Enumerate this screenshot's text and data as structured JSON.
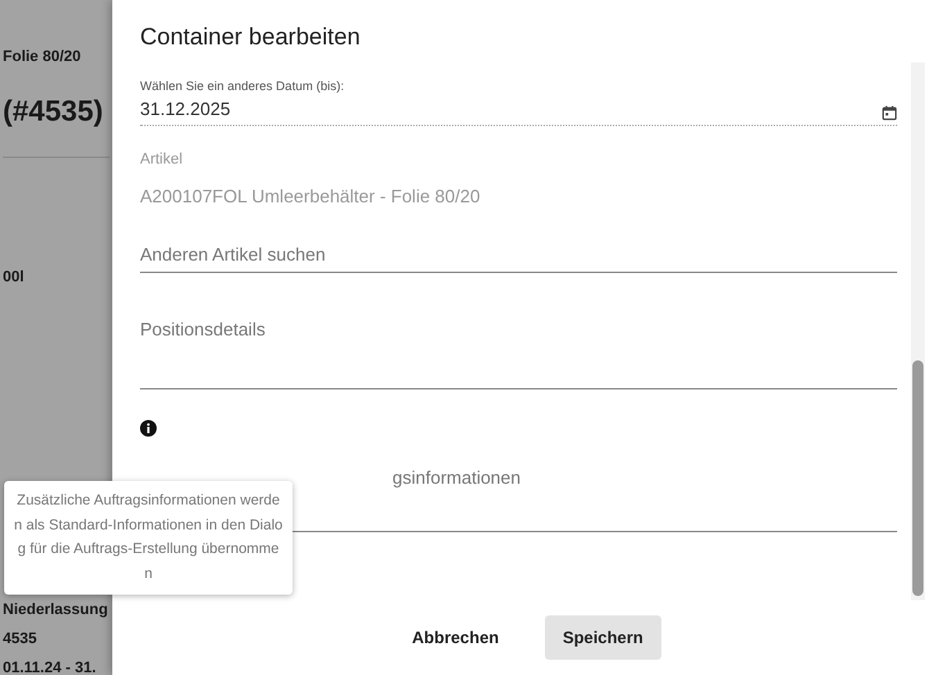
{
  "background": {
    "items": [
      {
        "kind": "subtitle",
        "text": "Folie 80/20"
      },
      {
        "kind": "heading",
        "text": "(#4535)"
      },
      {
        "kind": "value",
        "text": "00l"
      },
      {
        "kind": "label",
        "text": "Niederlassung"
      },
      {
        "kind": "value",
        "text": "4535"
      },
      {
        "kind": "value",
        "text": "01.11.24 - 31."
      }
    ]
  },
  "dialog": {
    "title": "Container bearbeiten",
    "fields": [
      {
        "kind": "date",
        "label": "Wählen Sie ein anderes Datum (bis):",
        "value": "31.12.2025"
      },
      {
        "kind": "readonly",
        "label": "Artikel",
        "value": "A200107FOL Umleerbehälter - Folie 80/20"
      },
      {
        "kind": "input",
        "placeholder": "Anderen Artikel suchen"
      },
      {
        "kind": "textarea",
        "placeholder": "Positionsdetails"
      },
      {
        "kind": "info"
      },
      {
        "kind": "textarea",
        "placeholder": "gsinformationen"
      }
    ],
    "buttons": [
      {
        "kind": "text",
        "label": "Abbrechen"
      },
      {
        "kind": "filled",
        "label": "Speichern"
      }
    ]
  },
  "tooltip": {
    "text": "Zusätzliche Auftragsinformationen werden als Standard-Informationen in den Dialog für die Auftrags-Erstellung übernommen"
  }
}
